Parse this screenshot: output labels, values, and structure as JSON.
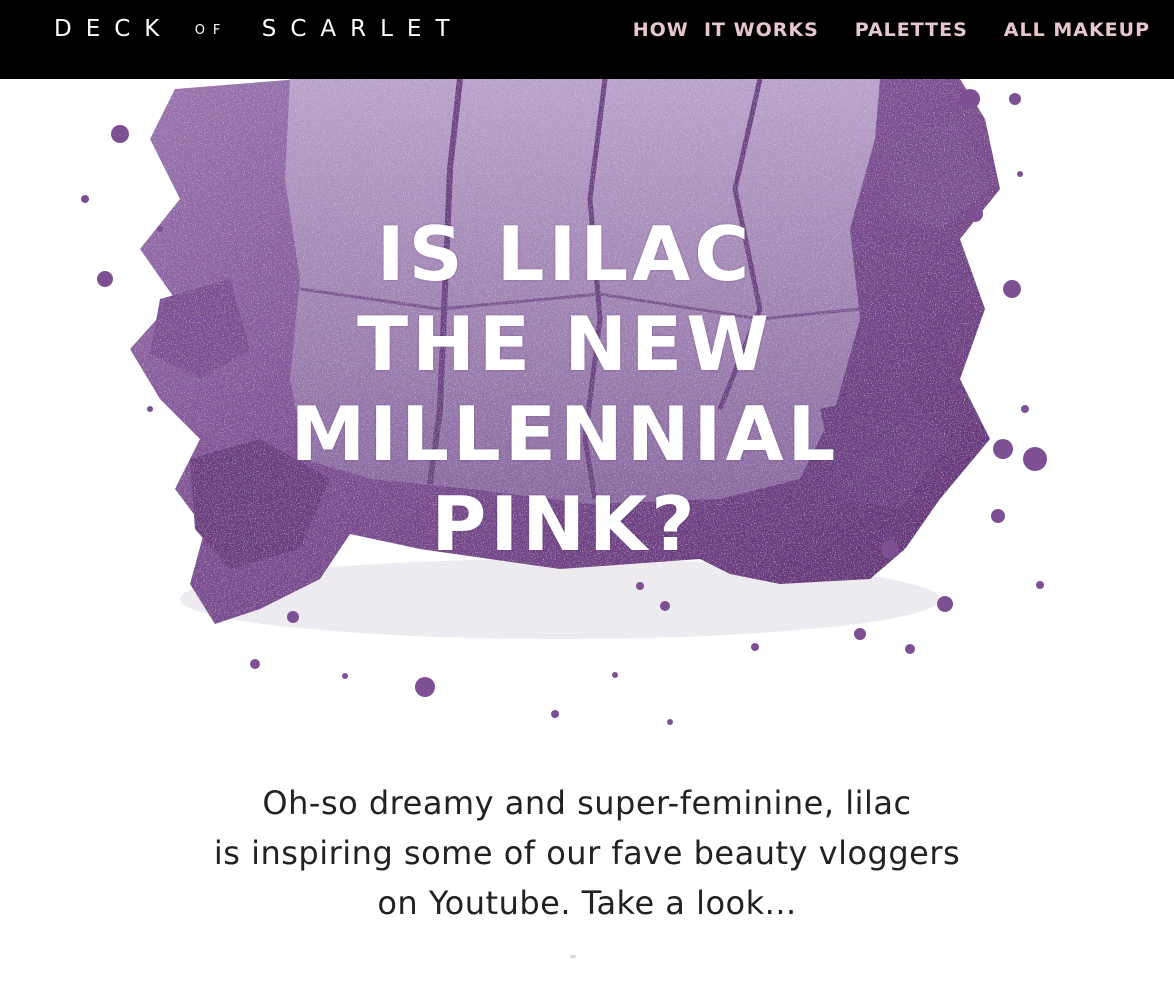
{
  "header": {
    "logo": {
      "deck": "DECK",
      "of": "OF",
      "scarlet": "SCARLET"
    },
    "nav": [
      {
        "label": "HOW  IT WORKS"
      },
      {
        "label": "PALETTES"
      },
      {
        "label": "ALL MAKEUP"
      }
    ]
  },
  "hero": {
    "image": "crushed-lilac-eyeshadow",
    "headline_lines": [
      "IS LILAC",
      "THE NEW",
      "MILLENNIAL",
      "PINK?"
    ]
  },
  "intro": {
    "lines": [
      "Oh-so dreamy and super-feminine, lilac",
      "is inspiring some of our fave beauty vloggers",
      "on Youtube. Take a look..."
    ]
  },
  "colors": {
    "header_bg": "#000000",
    "nav_text": "#e7c6cf",
    "eyeshadow_dark": "#6b3f7d",
    "eyeshadow_mid": "#8a5f9e",
    "eyeshadow_light": "#a98bbd"
  }
}
